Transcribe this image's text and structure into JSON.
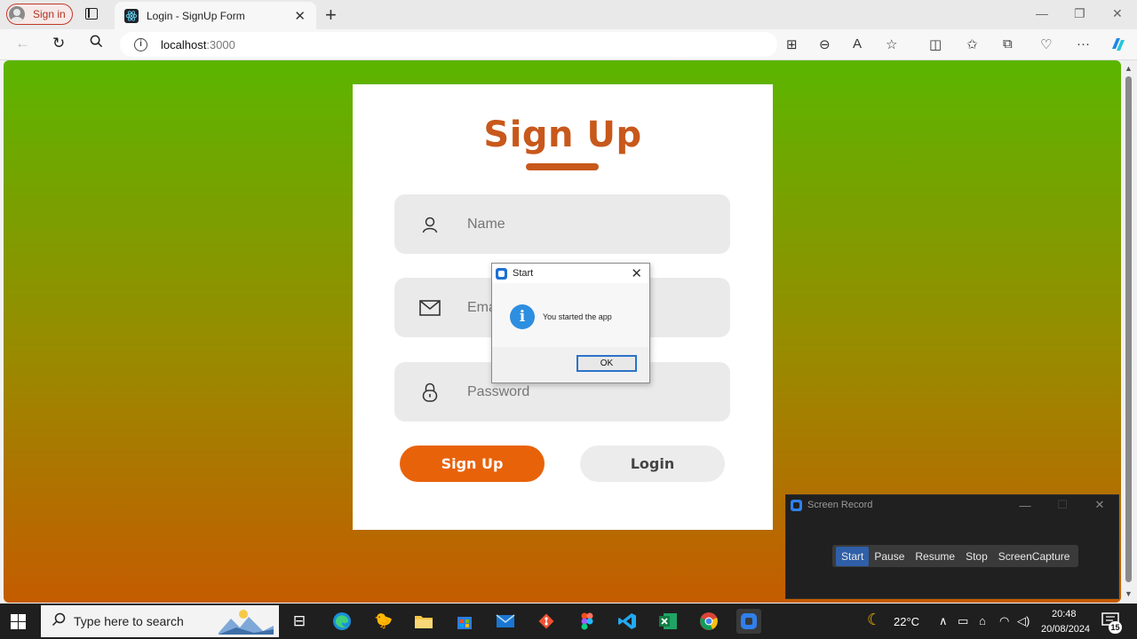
{
  "browser": {
    "profile_label": "Sign in",
    "tab_title": "Login - SignUp Form",
    "url_host": "localhost",
    "url_port": ":3000"
  },
  "page": {
    "title": "Sign Up",
    "fields": {
      "name_placeholder": "Name",
      "email_placeholder": "Email",
      "password_placeholder": "Password"
    },
    "signup_label": "Sign Up",
    "login_label": "Login"
  },
  "dialog": {
    "title": "Start",
    "message": "You started the app",
    "ok_label": "OK",
    "icon": "info-icon"
  },
  "recorder": {
    "title": "Screen Record",
    "buttons": [
      "Start",
      "Pause",
      "Resume",
      "Stop",
      "ScreenCapture"
    ],
    "active_button": "Start"
  },
  "taskbar": {
    "search_placeholder": "Type here to search",
    "weather": "22°C",
    "time": "20:48",
    "date": "20/08/2024",
    "notification_count": "15"
  },
  "colors": {
    "accent_orange": "#e8620a",
    "title_orange": "#c8581b",
    "gradient_top": "#5bb500",
    "gradient_bottom": "#c45c00"
  }
}
